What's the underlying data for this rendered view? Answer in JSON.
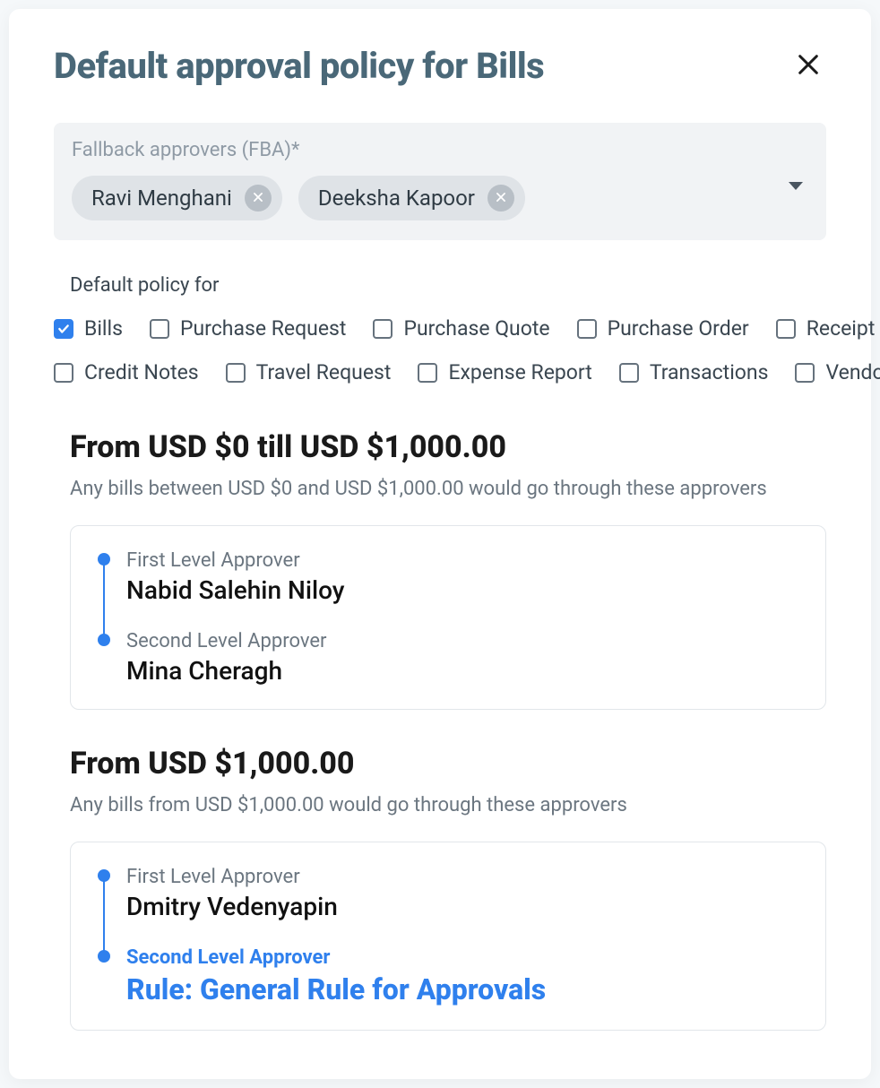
{
  "modal": {
    "title": "Default approval policy for Bills"
  },
  "fba": {
    "label": "Fallback approvers (FBA)*",
    "chips": [
      "Ravi Menghani",
      "Deeksha Kapoor"
    ]
  },
  "policy_for": {
    "label": "Default policy for",
    "row1": [
      {
        "label": "Bills",
        "checked": true
      },
      {
        "label": "Purchase Request",
        "checked": false
      },
      {
        "label": "Purchase Quote",
        "checked": false
      },
      {
        "label": "Purchase Order",
        "checked": false
      },
      {
        "label": "Receipt Notes",
        "checked": false
      }
    ],
    "row2": [
      {
        "label": "Credit Notes",
        "checked": false
      },
      {
        "label": "Travel Request",
        "checked": false
      },
      {
        "label": "Expense Report",
        "checked": false
      },
      {
        "label": "Transactions",
        "checked": false
      },
      {
        "label": "Vendors",
        "checked": false
      }
    ]
  },
  "ranges": [
    {
      "title": "From USD $0 till USD $1,000.00",
      "desc": "Any bills between USD $0 and USD $1,000.00 would go through these approvers",
      "approvers": [
        {
          "level": "First Level Approver",
          "name": "Nabid Salehin Niloy",
          "is_rule": false
        },
        {
          "level": "Second Level Approver",
          "name": "Mina Cheragh",
          "is_rule": false
        }
      ]
    },
    {
      "title": "From USD $1,000.00",
      "desc": "Any bills from USD $1,000.00 would go through these approvers",
      "approvers": [
        {
          "level": "First Level Approver",
          "name": "Dmitry Vedenyapin",
          "is_rule": false
        },
        {
          "level": "Second Level Approver",
          "name": "Rule: General Rule for Approvals",
          "is_rule": true
        }
      ]
    }
  ]
}
